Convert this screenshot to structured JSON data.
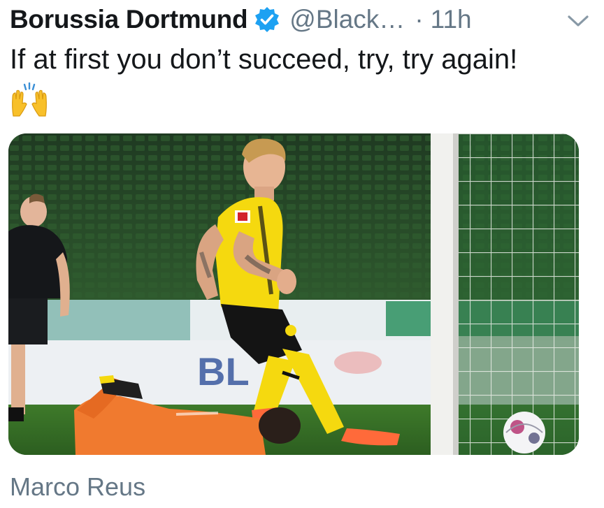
{
  "tweet": {
    "author_name": "Borussia Dortmund",
    "handle": "@Black…",
    "separator": "·",
    "time": "11h",
    "text": "If at first you don’t succeed, try, try again!",
    "emoji": "raising-hands-emoji",
    "media_alt": "Player in yellow kit beside goal net with goalkeeper diving and ball at goal line",
    "footer_name": "Marco Reus"
  },
  "icons": {
    "verified": "verified-badge-icon",
    "caret": "chevron-down-icon"
  },
  "colors": {
    "verified_blue": "#1da1f2",
    "secondary_text": "#657786",
    "primary_text": "#14171a",
    "kit_yellow": "#f5d90f",
    "goalkeeper_orange": "#f07a2f"
  }
}
